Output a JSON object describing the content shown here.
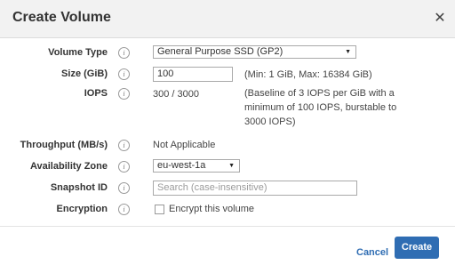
{
  "dialog": {
    "title": "Create Volume",
    "close_icon": "close-icon",
    "info_glyph": "i"
  },
  "fields": {
    "volume_type": {
      "label": "Volume Type",
      "selected": "General Purpose SSD (GP2)"
    },
    "size": {
      "label": "Size (GiB)",
      "value": "100",
      "hint": "(Min: 1 GiB, Max: 16384 GiB)"
    },
    "iops": {
      "label": "IOPS",
      "value": "300 / 3000",
      "hint_line1": "(Baseline of 3 IOPS per GiB with a",
      "hint_line2": "minimum of 100 IOPS, burstable to",
      "hint_line3": "3000 IOPS)"
    },
    "throughput": {
      "label": "Throughput (MB/s)",
      "value": "Not Applicable"
    },
    "availability_zone": {
      "label": "Availability Zone",
      "selected": "eu-west-1a"
    },
    "snapshot_id": {
      "label": "Snapshot ID",
      "placeholder": "Search (case-insensitive)"
    },
    "encryption": {
      "label": "Encryption",
      "checkbox_label": "Encrypt this volume",
      "checked": false
    }
  },
  "footer": {
    "cancel_label": "Cancel",
    "create_label": "Create"
  },
  "colors": {
    "primary": "#2f6db3",
    "header_bg": "#f2f2f2"
  }
}
